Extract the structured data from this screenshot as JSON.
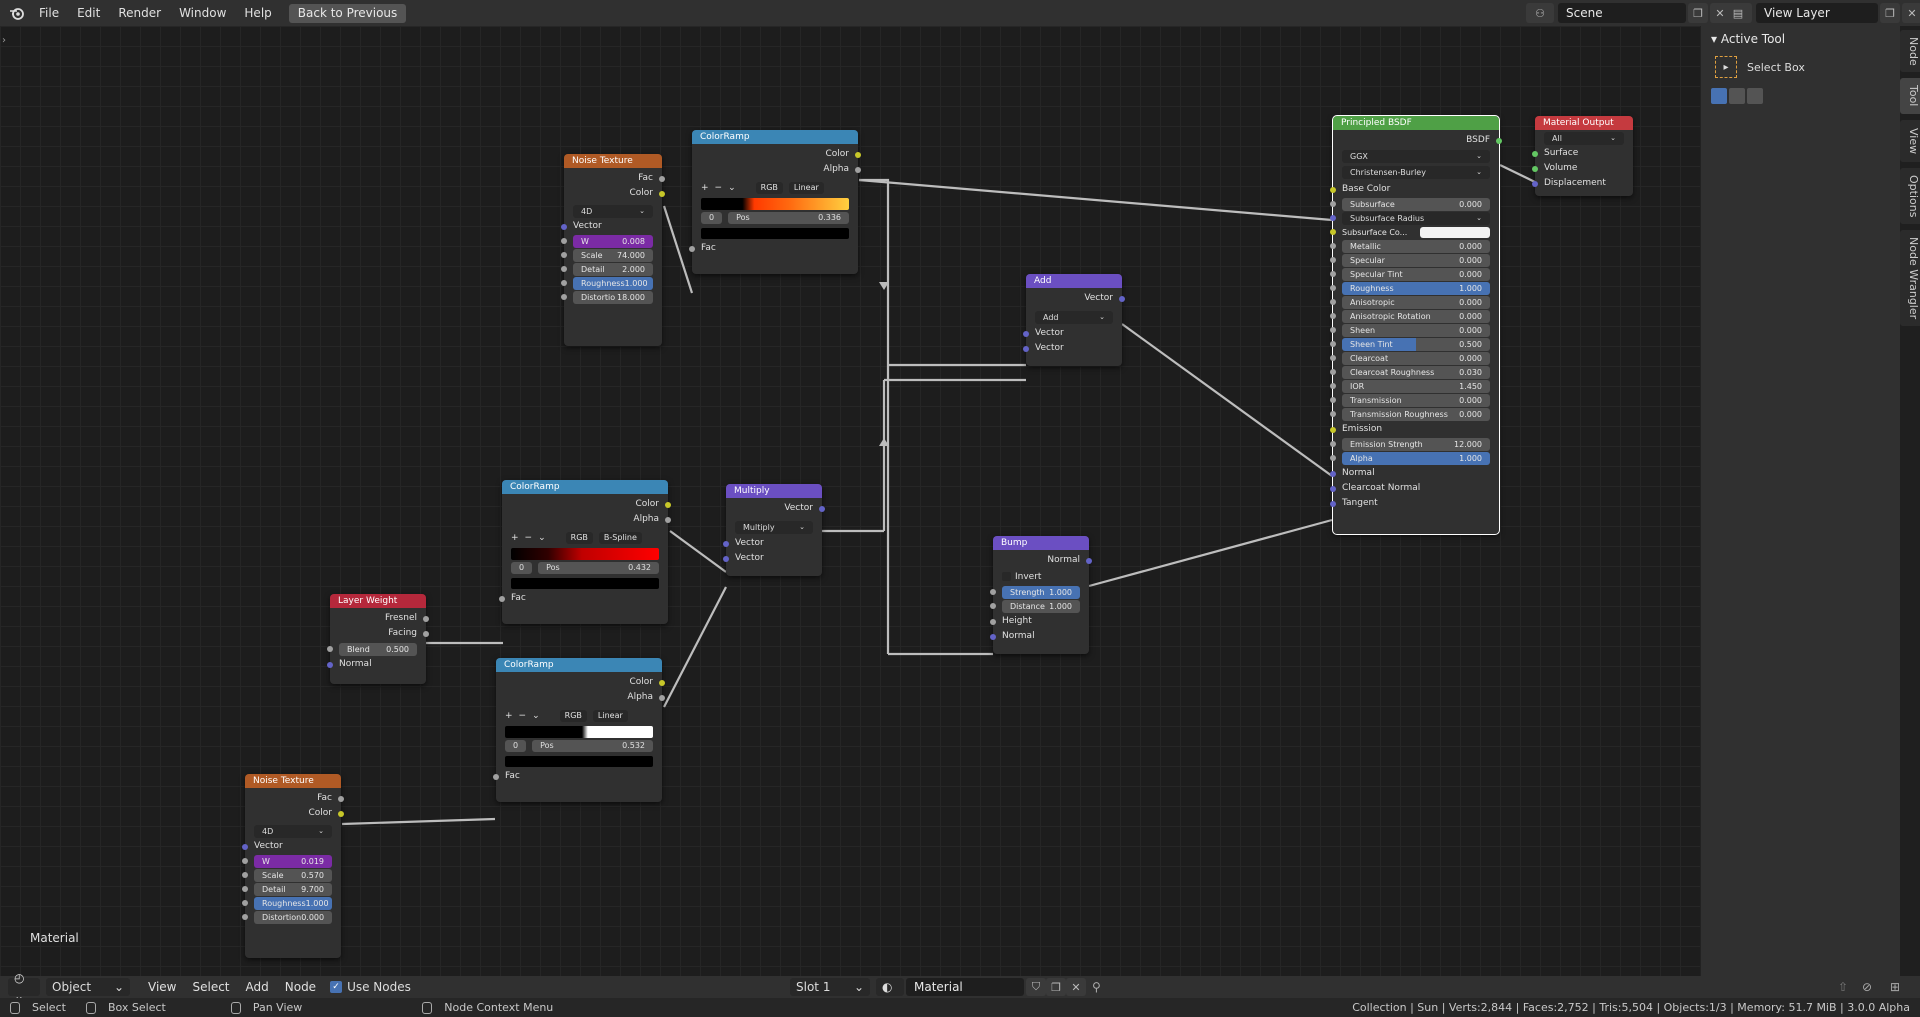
{
  "topbar": {
    "menus": [
      "File",
      "Edit",
      "Render",
      "Window",
      "Help"
    ],
    "back_button": "Back to Previous",
    "scene": "Scene",
    "view_layer": "View Layer"
  },
  "editor": {
    "material_label": "Material"
  },
  "nodes": {
    "noise1": {
      "title": "Noise Texture",
      "out1": "Fac",
      "out2": "Color",
      "dims": "4D",
      "in_vec": "Vector",
      "w_l": "W",
      "w_v": "0.008",
      "scale_l": "Scale",
      "scale_v": "74.000",
      "detail_l": "Detail",
      "detail_v": "2.000",
      "rough_l": "Roughness",
      "rough_v": "1.000",
      "dist_l": "Distortio",
      "dist_v": "18.000"
    },
    "ramp1": {
      "title": "ColorRamp",
      "out1": "Color",
      "out2": "Alpha",
      "mode": "RGB",
      "interp": "Linear",
      "stop": "0",
      "pos_l": "Pos",
      "pos_v": "0.336",
      "in": "Fac"
    },
    "add": {
      "title": "Add",
      "out": "Vector",
      "op": "Add",
      "in1": "Vector",
      "in2": "Vector"
    },
    "ramp2": {
      "title": "ColorRamp",
      "out1": "Color",
      "out2": "Alpha",
      "mode": "RGB",
      "interp": "B-Spline",
      "stop": "0",
      "pos_l": "Pos",
      "pos_v": "0.432",
      "in": "Fac"
    },
    "multiply": {
      "title": "Multiply",
      "out": "Vector",
      "op": "Multiply",
      "in1": "Vector",
      "in2": "Vector"
    },
    "layerweight": {
      "title": "Layer Weight",
      "out1": "Fresnel",
      "out2": "Facing",
      "blend_l": "Blend",
      "blend_v": "0.500",
      "in": "Normal"
    },
    "ramp3": {
      "title": "ColorRamp",
      "out1": "Color",
      "out2": "Alpha",
      "mode": "RGB",
      "interp": "Linear",
      "stop": "0",
      "pos_l": "Pos",
      "pos_v": "0.532",
      "in": "Fac"
    },
    "noise2": {
      "title": "Noise Texture",
      "out1": "Fac",
      "out2": "Color",
      "dims": "4D",
      "in_vec": "Vector",
      "w_l": "W",
      "w_v": "0.019",
      "scale_l": "Scale",
      "scale_v": "0.570",
      "detail_l": "Detail",
      "detail_v": "9.700",
      "rough_l": "Roughness",
      "rough_v": "1.000",
      "dist_l": "Distortion",
      "dist_v": "0.000"
    },
    "bump": {
      "title": "Bump",
      "out": "Normal",
      "invert": "Invert",
      "strength_l": "Strength",
      "strength_v": "1.000",
      "distance_l": "Distance",
      "distance_v": "1.000",
      "in1": "Height",
      "in2": "Normal"
    },
    "bsdf": {
      "title": "Principled BSDF",
      "out": "BSDF",
      "dist": "GGX",
      "sss": "Christensen-Burley",
      "rows": [
        {
          "k": "basecolor",
          "label": "Base Color",
          "type": "socket"
        },
        {
          "k": "subsurface",
          "label": "Subsurface",
          "value": "0.000",
          "type": "field"
        },
        {
          "k": "ssradius",
          "label": "Subsurface Radius",
          "type": "drop"
        },
        {
          "k": "sscolor",
          "label": "Subsurface Co...",
          "type": "color"
        },
        {
          "k": "metallic",
          "label": "Metallic",
          "value": "0.000",
          "type": "field"
        },
        {
          "k": "specular",
          "label": "Specular",
          "value": "0.000",
          "type": "field"
        },
        {
          "k": "spectint",
          "label": "Specular Tint",
          "value": "0.000",
          "type": "field"
        },
        {
          "k": "roughness",
          "label": "Roughness",
          "value": "1.000",
          "type": "blue"
        },
        {
          "k": "aniso",
          "label": "Anisotropic",
          "value": "0.000",
          "type": "field"
        },
        {
          "k": "anisorot",
          "label": "Anisotropic Rotation",
          "value": "0.000",
          "type": "field"
        },
        {
          "k": "sheen",
          "label": "Sheen",
          "value": "0.000",
          "type": "field"
        },
        {
          "k": "sheentint",
          "label": "Sheen Tint",
          "value": "0.500",
          "type": "half"
        },
        {
          "k": "clearcoat",
          "label": "Clearcoat",
          "value": "0.000",
          "type": "field"
        },
        {
          "k": "ccrough",
          "label": "Clearcoat Roughness",
          "value": "0.030",
          "type": "field"
        },
        {
          "k": "ior",
          "label": "IOR",
          "value": "1.450",
          "type": "field"
        },
        {
          "k": "transmission",
          "label": "Transmission",
          "value": "0.000",
          "type": "field"
        },
        {
          "k": "transrough",
          "label": "Transmission Roughness",
          "value": "0.000",
          "type": "field"
        },
        {
          "k": "emission",
          "label": "Emission",
          "type": "socket"
        },
        {
          "k": "emstrength",
          "label": "Emission Strength",
          "value": "12.000",
          "type": "field"
        },
        {
          "k": "alpha",
          "label": "Alpha",
          "value": "1.000",
          "type": "blue"
        },
        {
          "k": "normal",
          "label": "Normal",
          "type": "socket"
        },
        {
          "k": "ccnormal",
          "label": "Clearcoat Normal",
          "type": "socket"
        },
        {
          "k": "tangent",
          "label": "Tangent",
          "type": "socket"
        }
      ]
    },
    "output": {
      "title": "Material Output",
      "target": "All",
      "in1": "Surface",
      "in2": "Volume",
      "in3": "Displacement"
    }
  },
  "sidebar": {
    "panel": "Active Tool",
    "tool": "Select Box",
    "tabs": [
      "Node",
      "Tool",
      "View",
      "Options",
      "Node Wrangler"
    ]
  },
  "header2": {
    "mode": "Object",
    "menus": [
      "View",
      "Select",
      "Add",
      "Node"
    ],
    "use_nodes": "Use Nodes",
    "slot": "Slot 1",
    "material": "Material"
  },
  "status": {
    "select": "Select",
    "box_select": "Box Select",
    "pan": "Pan View",
    "context": "Node Context Menu",
    "stats": "Collection | Sun | Verts:2,844 | Faces:2,752 | Tris:5,504 | Objects:1/3 | Memory: 51.7 MiB | 3.0.0 Alpha"
  },
  "colors": {
    "noise": "#b05a25",
    "ramp": "#3b86b5",
    "vector": "#6b4fc2",
    "input": "#b5283b",
    "shader": "#4fa046",
    "output": "#c53a3f",
    "socket_yellow": "#c7c729",
    "socket_grey": "#a1a1a1",
    "socket_purple": "#6363c7",
    "socket_green": "#63c763"
  }
}
